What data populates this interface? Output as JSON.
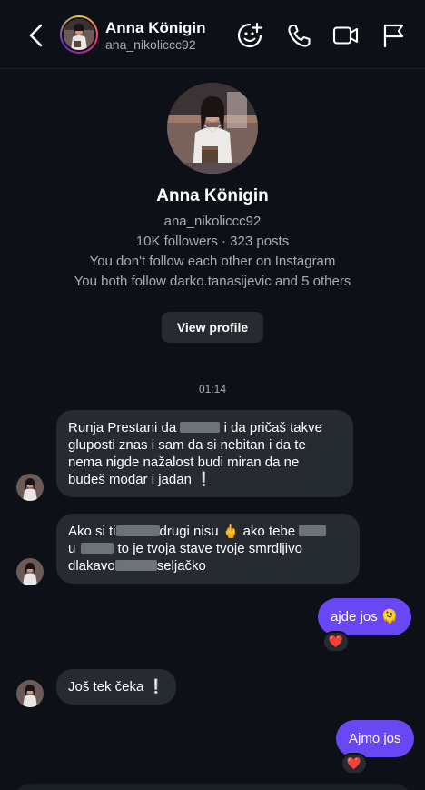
{
  "header": {
    "name": "Anna Königin",
    "username": "ana_nikoliccc92",
    "icons": [
      "back-icon",
      "sticker-add-icon",
      "phone-icon",
      "video-icon",
      "flag-icon"
    ]
  },
  "profile": {
    "name": "Anna Königin",
    "username": "ana_nikoliccc92",
    "stats": "10K followers · 323 posts",
    "follow_status": "You don't follow each other on Instagram",
    "mutual": "You both follow darko.tanasijevic and 5 others",
    "view_profile": "View profile"
  },
  "timestamp": "01:14",
  "messages": [
    {
      "lines": [
        [
          "Runja Prestani da ",
          "",
          " i da pričaš takve"
        ],
        [
          "gluposti znas i sam da si nebitan i da te"
        ],
        [
          "nema nigde nažalost  budi miran da ne"
        ],
        [
          "budeš modar i jadan ",
          "❕"
        ]
      ]
    },
    {
      "lines": [
        [
          "Ako si ti",
          "",
          "drugi nisu ",
          "🖕",
          " ako tebe"
        ],
        [
          "u",
          "",
          " to je tvoja stave tvoje smrdljivo"
        ],
        [
          "dlakavo",
          "",
          "seljačko"
        ]
      ]
    },
    {
      "text": "ajde jos ",
      "emoji": "🫠",
      "reaction": "❤️"
    },
    {
      "text": "Još  tek čeka ",
      "emoji": "❕"
    },
    {
      "text": "Ajmo jos",
      "reaction": "❤️"
    }
  ],
  "colors": {
    "background": "#0d1117",
    "incoming_bubble": "#262a31",
    "outgoing_bubble": "#6848f5",
    "secondary_text": "#a8adb5"
  }
}
